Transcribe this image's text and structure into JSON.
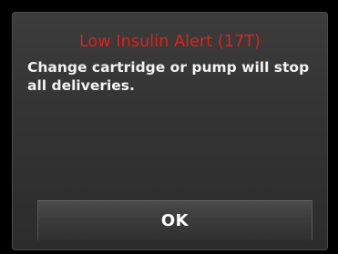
{
  "alert": {
    "title": "Low Insulin Alert (17T)",
    "message": "Change cartridge or pump will stop all deliveries.",
    "title_color": "#e32119"
  },
  "actions": {
    "ok_label": "OK"
  }
}
